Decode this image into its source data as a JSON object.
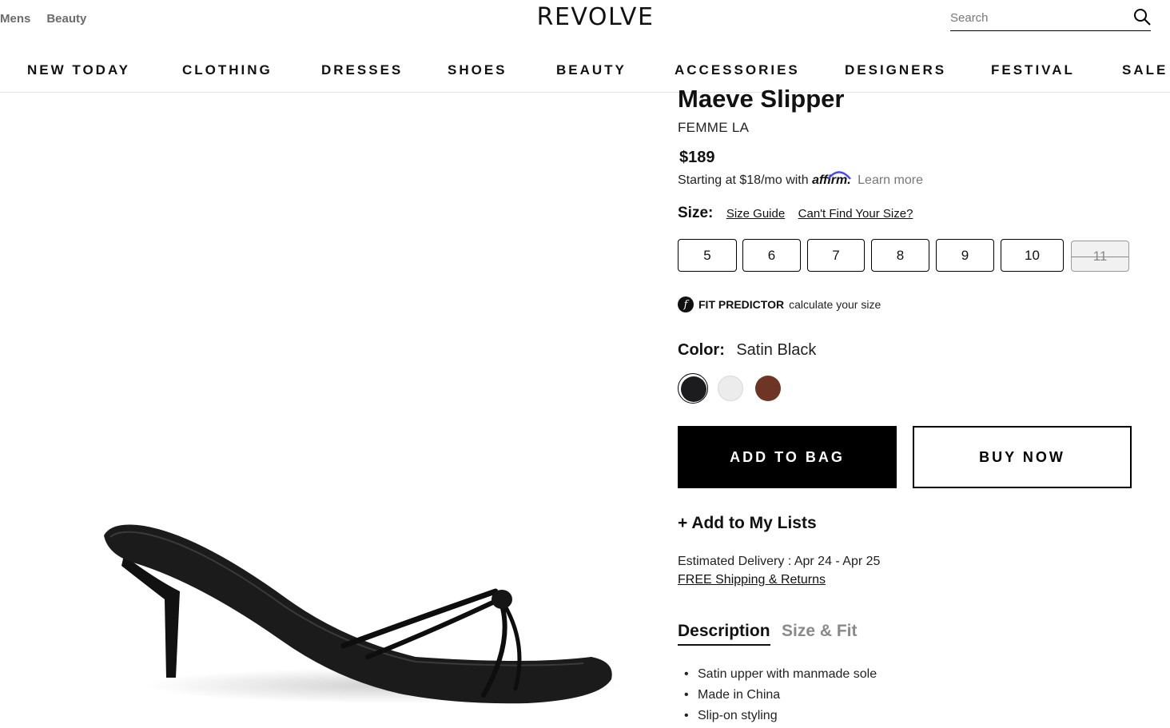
{
  "header": {
    "top_links": [
      "Mens",
      "Beauty"
    ],
    "logo": "REVOLVE",
    "search_placeholder": "Search",
    "nav": [
      "NEW TODAY",
      "CLOTHING",
      "DRESSES",
      "SHOES",
      "BEAUTY",
      "ACCESSORIES",
      "DESIGNERS",
      "FESTIVAL",
      "SALE"
    ]
  },
  "product": {
    "title": "Maeve Slipper",
    "brand": "FEMME LA",
    "price": "$189",
    "affirm_text": "Starting at $18/mo with",
    "affirm_logo": "affirm",
    "affirm_learn_more": "Learn more",
    "size_label": "Size:",
    "size_guide": "Size Guide",
    "cant_find_size": "Can't Find Your Size?",
    "sizes": [
      {
        "label": "5",
        "available": true
      },
      {
        "label": "6",
        "available": true
      },
      {
        "label": "7",
        "available": true
      },
      {
        "label": "8",
        "available": true
      },
      {
        "label": "9",
        "available": true
      },
      {
        "label": "10",
        "available": true
      },
      {
        "label": "11",
        "available": false
      }
    ],
    "fit_predictor_label": "FIT PREDICTOR",
    "fit_predictor_sub": "calculate your size",
    "color_label": "Color:",
    "color_value": "Satin Black",
    "swatches": [
      {
        "name": "black",
        "color": "#1c1c1e",
        "selected": true
      },
      {
        "name": "white",
        "color": "#ececec",
        "selected": false
      },
      {
        "name": "brown",
        "color": "#6e3424",
        "selected": false
      }
    ],
    "add_to_bag": "ADD TO BAG",
    "buy_now": "BUY NOW",
    "add_to_lists": "+ Add to My Lists",
    "delivery": "Estimated Delivery : Apr 24 - Apr 25",
    "free_shipping": "FREE Shipping & Returns",
    "tabs": [
      "Description",
      "Size & Fit"
    ],
    "description": [
      "Satin upper with manmade sole",
      "Made in China",
      "Slip-on styling"
    ]
  }
}
